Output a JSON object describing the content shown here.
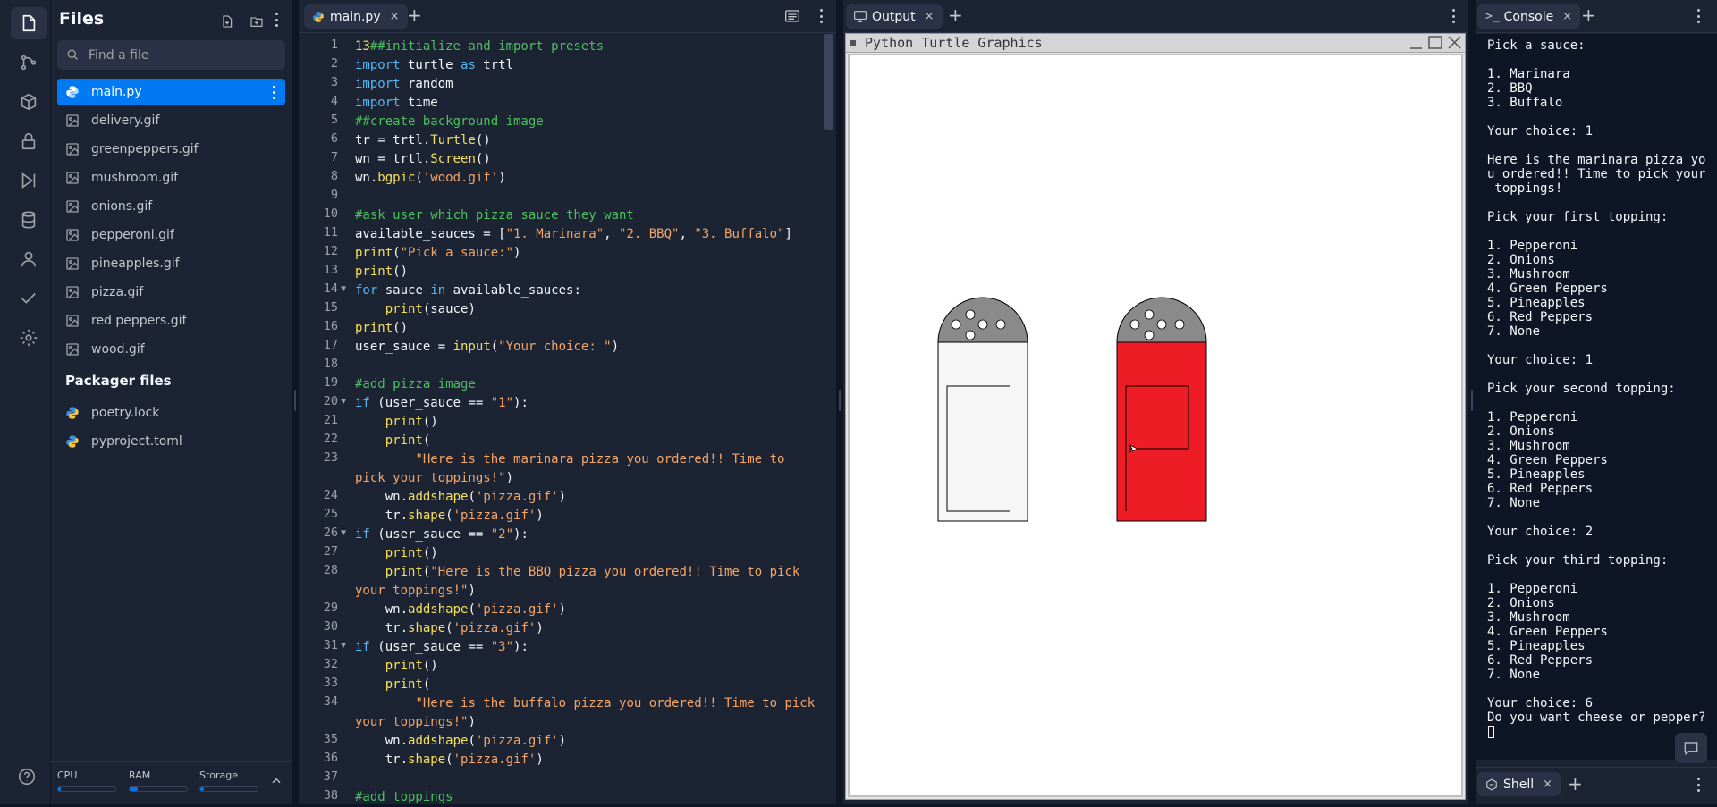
{
  "sidebar_icons": [
    "files-icon",
    "git-icon",
    "packages-icon",
    "secrets-icon",
    "run-icon",
    "database-icon",
    "user-icon",
    "check-icon",
    "settings-icon"
  ],
  "help_label": "?",
  "files_panel": {
    "title": "Files",
    "search_placeholder": "Find a file",
    "files": [
      {
        "name": "main.py",
        "type": "python",
        "selected": true
      },
      {
        "name": "delivery.gif",
        "type": "image"
      },
      {
        "name": "greenpeppers.gif",
        "type": "image"
      },
      {
        "name": "mushroom.gif",
        "type": "image"
      },
      {
        "name": "onions.gif",
        "type": "image"
      },
      {
        "name": "pepperoni.gif",
        "type": "image"
      },
      {
        "name": "pineapples.gif",
        "type": "image"
      },
      {
        "name": "pizza.gif",
        "type": "image"
      },
      {
        "name": "red peppers.gif",
        "type": "image"
      },
      {
        "name": "wood.gif",
        "type": "image"
      }
    ],
    "packager_title": "Packager files",
    "packager_files": [
      {
        "name": "poetry.lock",
        "type": "python"
      },
      {
        "name": "pyproject.toml",
        "type": "python"
      }
    ]
  },
  "resources": {
    "cpu_label": "CPU",
    "cpu_level": 0.05,
    "ram_label": "RAM",
    "ram_level": 0.14,
    "storage_label": "Storage",
    "storage_level": 0.06
  },
  "editor": {
    "tab_label": "main.py",
    "tab_close": "×",
    "lines": [
      {
        "n": "1",
        "html": "<span class='n'>13</span><span class='c'>##initialize and import presets</span>"
      },
      {
        "n": "2",
        "html": "<span class='k'>import</span> turtle <span class='k'>as</span> trtl"
      },
      {
        "n": "3",
        "html": "<span class='k'>import</span> random"
      },
      {
        "n": "4",
        "html": "<span class='k'>import</span> time"
      },
      {
        "n": "5",
        "html": "<span class='c'>##create background image</span>"
      },
      {
        "n": "6",
        "html": "tr = trtl.<span class='f'>Turtle</span>()"
      },
      {
        "n": "7",
        "html": "wn = trtl.<span class='f'>Screen</span>()"
      },
      {
        "n": "8",
        "html": "wn.<span class='f'>bgpic</span>(<span class='s'>'wood.gif'</span>)"
      },
      {
        "n": "9",
        "html": ""
      },
      {
        "n": "10",
        "html": "<span class='c'>#ask user which pizza sauce they want</span>"
      },
      {
        "n": "11",
        "html": "available_sauces = [<span class='s'>\"1. Marinara\"</span>, <span class='s'>\"2. BBQ\"</span>, <span class='s'>\"3. Buffalo\"</span>]"
      },
      {
        "n": "12",
        "html": "<span class='f'>print</span>(<span class='s'>\"Pick a sauce:\"</span>)"
      },
      {
        "n": "13",
        "html": "<span class='f'>print</span>()"
      },
      {
        "n": "14",
        "fold": true,
        "html": "<span class='k'>for</span> sauce <span class='k'>in</span> available_sauces:"
      },
      {
        "n": "15",
        "html": "    <span class='f'>print</span>(sauce)"
      },
      {
        "n": "16",
        "html": "<span class='f'>print</span>()"
      },
      {
        "n": "17",
        "html": "user_sauce = <span class='f'>input</span>(<span class='s'>\"Your choice: \"</span>)"
      },
      {
        "n": "18",
        "html": ""
      },
      {
        "n": "19",
        "html": "<span class='c'>#add pizza image</span>"
      },
      {
        "n": "20",
        "fold": true,
        "html": "<span class='k'>if</span> (user_sauce == <span class='s'>\"1\"</span>):"
      },
      {
        "n": "21",
        "html": "    <span class='f'>print</span>()"
      },
      {
        "n": "22",
        "html": "    <span class='f'>print</span>("
      },
      {
        "n": "23",
        "html": "        <span class='s'>\"Here is the marinara pizza you ordered!! Time to</span>\n<span class='s'>pick your toppings!\"</span>)"
      },
      {
        "n": "24",
        "html": "    wn.<span class='f'>addshape</span>(<span class='s'>'pizza.gif'</span>)"
      },
      {
        "n": "25",
        "html": "    tr.<span class='f'>shape</span>(<span class='s'>'pizza.gif'</span>)"
      },
      {
        "n": "26",
        "fold": true,
        "html": "<span class='k'>if</span> (user_sauce == <span class='s'>\"2\"</span>):"
      },
      {
        "n": "27",
        "html": "    <span class='f'>print</span>()"
      },
      {
        "n": "28",
        "html": "    <span class='f'>print</span>(<span class='s'>\"Here is the BBQ pizza you ordered!! Time to pick</span>\n<span class='s'>your toppings!\"</span>)"
      },
      {
        "n": "29",
        "html": "    wn.<span class='f'>addshape</span>(<span class='s'>'pizza.gif'</span>)"
      },
      {
        "n": "30",
        "html": "    tr.<span class='f'>shape</span>(<span class='s'>'pizza.gif'</span>)"
      },
      {
        "n": "31",
        "fold": true,
        "html": "<span class='k'>if</span> (user_sauce == <span class='s'>\"3\"</span>):"
      },
      {
        "n": "32",
        "html": "    <span class='f'>print</span>()"
      },
      {
        "n": "33",
        "html": "    <span class='f'>print</span>("
      },
      {
        "n": "34",
        "html": "        <span class='s'>\"Here is the buffalo pizza you ordered!! Time to pick</span>\n<span class='s'>your toppings!\"</span>)"
      },
      {
        "n": "35",
        "html": "    wn.<span class='f'>addshape</span>(<span class='s'>'pizza.gif'</span>)"
      },
      {
        "n": "36",
        "html": "    tr.<span class='f'>shape</span>(<span class='s'>'pizza.gif'</span>)"
      },
      {
        "n": "37",
        "html": ""
      },
      {
        "n": "38",
        "html": "<span class='c'>#add toppings</span>"
      }
    ]
  },
  "output": {
    "tab_label": "Output",
    "tab_close": "×",
    "window_title": "Python Turtle Graphics",
    "colors": {
      "shaker_cap": "#8a8a8a",
      "shaker_body_left": "#f6f6f6",
      "shaker_body_right": "#ee1c24"
    }
  },
  "console": {
    "tab_label": "Console",
    "tab_close": "×",
    "lines": [
      "Pick a sauce:",
      "",
      "1. Marinara",
      "2. BBQ",
      "3. Buffalo",
      "",
      "Your choice: 1",
      "",
      "Here is the marinara pizza yo",
      "u ordered!! Time to pick your",
      " toppings!",
      "",
      "Pick your first topping:",
      "",
      "1. Pepperoni",
      "2. Onions",
      "3. Mushroom",
      "4. Green Peppers",
      "5. Pineapples",
      "6. Red Peppers",
      "7. None",
      "",
      "Your choice: 1",
      "",
      "Pick your second topping:",
      "",
      "1. Pepperoni",
      "2. Onions",
      "3. Mushroom",
      "4. Green Peppers",
      "5. Pineapples",
      "6. Red Peppers",
      "7. None",
      "",
      "Your choice: 2",
      "",
      "Pick your third topping:",
      "",
      "1. Pepperoni",
      "2. Onions",
      "3. Mushroom",
      "4. Green Peppers",
      "5. Pineapples",
      "6. Red Peppers",
      "7. None",
      "",
      "Your choice: 6",
      "Do you want cheese or pepper?"
    ]
  },
  "shell": {
    "tab_label": "Shell",
    "tab_close": "×"
  },
  "colors": {
    "accent": "#0079f2",
    "background": "#0e1525",
    "panel": "#1c2333"
  }
}
